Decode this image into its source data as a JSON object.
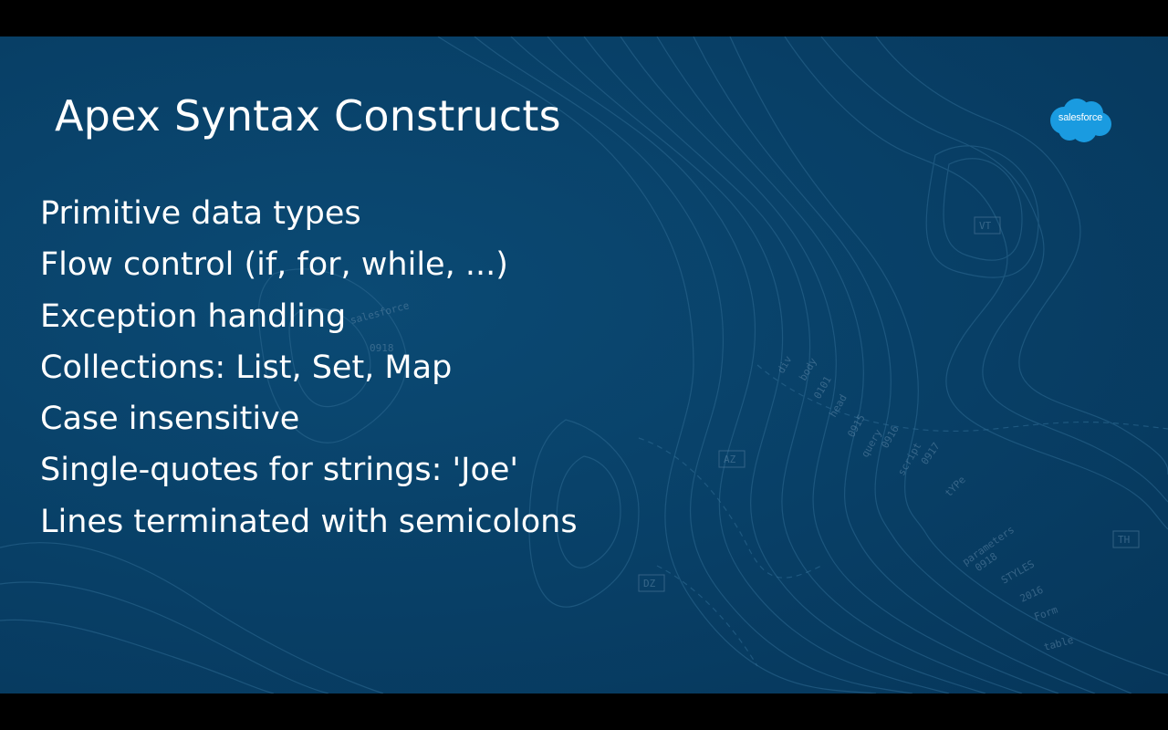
{
  "slide": {
    "title": "Apex Syntax Constructs",
    "logo_text": "salesforce",
    "bullets": [
      "Primitive data types",
      "Flow control (if, for, while, ...)",
      "Exception handling",
      "Collections: List, Set, Map",
      "Case insensitive",
      "Single-quotes for strings: 'Joe'",
      "Lines terminated with semicolons"
    ],
    "background_labels": {
      "div": "div",
      "body": "body",
      "code_0101": "0101",
      "head": "head",
      "code_0915": "0915",
      "query": "query",
      "code_0916": "0916",
      "script": "script",
      "code_0917": "0917",
      "type": "tYPe",
      "parameters": "parameters",
      "code_0918": "0918",
      "styles": "STYLES",
      "code_2016": "2016",
      "form": "Form",
      "table": "table",
      "box_az": "AZ",
      "box_dz": "DZ",
      "box_th": "TH",
      "box_vt": "VT",
      "faint_a": "salesforce",
      "faint_b": "0918"
    }
  },
  "colors": {
    "background": "#083f66",
    "text": "#ffffff",
    "logo_cloud": "#1a9be0",
    "contour_line": "#2e6a92"
  }
}
